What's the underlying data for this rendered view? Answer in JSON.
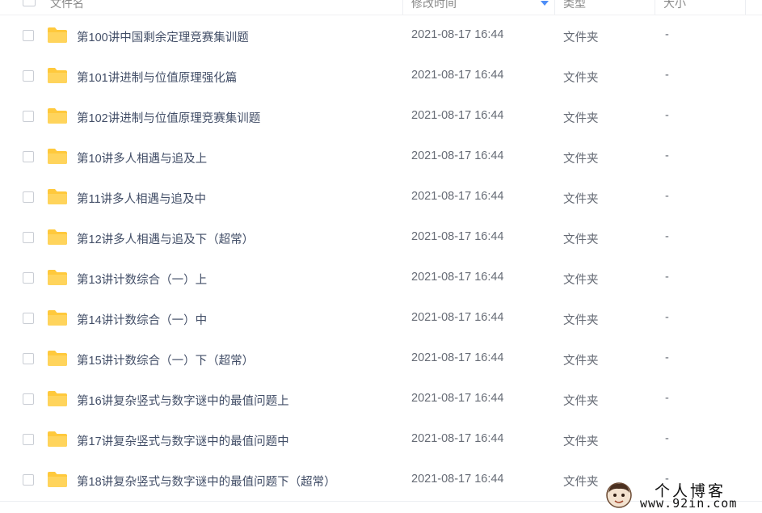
{
  "columns": {
    "name": "文件名",
    "modified": "修改时间",
    "type": "类型",
    "size": "大小"
  },
  "sort": {
    "column": "modified",
    "direction": "desc",
    "icon": "sort-down-icon",
    "color": "#4e8ef7"
  },
  "folder_color": "#ffc93c",
  "rows": [
    {
      "name": "第100讲中国剩余定理竞赛集训题",
      "modified": "2021-08-17 16:44",
      "type": "文件夹",
      "size": "-"
    },
    {
      "name": "第101讲进制与位值原理强化篇",
      "modified": "2021-08-17 16:44",
      "type": "文件夹",
      "size": "-"
    },
    {
      "name": "第102讲进制与位值原理竞赛集训题",
      "modified": "2021-08-17 16:44",
      "type": "文件夹",
      "size": "-"
    },
    {
      "name": "第10讲多人相遇与追及上",
      "modified": "2021-08-17 16:44",
      "type": "文件夹",
      "size": "-"
    },
    {
      "name": "第11讲多人相遇与追及中",
      "modified": "2021-08-17 16:44",
      "type": "文件夹",
      "size": "-"
    },
    {
      "name": "第12讲多人相遇与追及下（超常）",
      "modified": "2021-08-17 16:44",
      "type": "文件夹",
      "size": "-"
    },
    {
      "name": "第13讲计数综合（一）上",
      "modified": "2021-08-17 16:44",
      "type": "文件夹",
      "size": "-"
    },
    {
      "name": "第14讲计数综合（一）中",
      "modified": "2021-08-17 16:44",
      "type": "文件夹",
      "size": "-"
    },
    {
      "name": "第15讲计数综合（一）下（超常）",
      "modified": "2021-08-17 16:44",
      "type": "文件夹",
      "size": "-"
    },
    {
      "name": "第16讲复杂竖式与数字谜中的最值问题上",
      "modified": "2021-08-17 16:44",
      "type": "文件夹",
      "size": "-"
    },
    {
      "name": "第17讲复杂竖式与数字谜中的最值问题中",
      "modified": "2021-08-17 16:44",
      "type": "文件夹",
      "size": "-"
    },
    {
      "name": "第18讲复杂竖式与数字谜中的最值问题下（超常）",
      "modified": "2021-08-17 16:44",
      "type": "文件夹",
      "size": "-"
    }
  ],
  "watermark": {
    "title": "个人博客",
    "url": "www.92in.com"
  }
}
